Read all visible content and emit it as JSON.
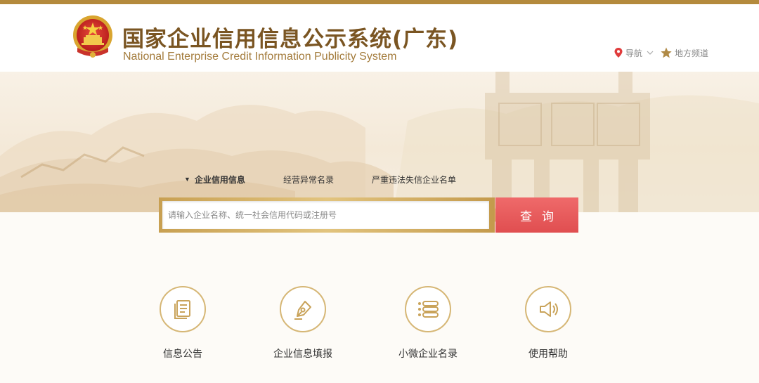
{
  "header": {
    "title_cn": "国家企业信用信息公示系统(广东)",
    "title_en": "National Enterprise Credit Information Publicity System",
    "nav": {
      "label": "导航",
      "local": "地方频道"
    }
  },
  "search": {
    "tabs": [
      "企业信用信息",
      "经营异常名录",
      "严重违法失信企业名单"
    ],
    "active_tab": "企业信用信息",
    "placeholder": "请输入企业名称、统一社会信用代码或注册号",
    "button": "查询"
  },
  "quick_links": [
    {
      "label": "信息公告",
      "icon": "document-icon"
    },
    {
      "label": "企业信息填报",
      "icon": "pen-nib-icon"
    },
    {
      "label": "小微企业名录",
      "icon": "list-icon"
    },
    {
      "label": "使用帮助",
      "icon": "speaker-icon"
    }
  ],
  "colors": {
    "gold": "#b48a3c",
    "brown": "#7a5522",
    "red": "#e04e50"
  }
}
